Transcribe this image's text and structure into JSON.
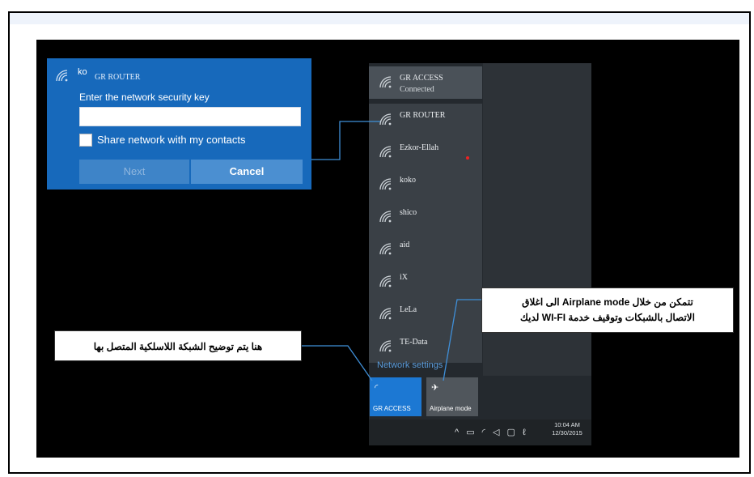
{
  "dialog": {
    "ko_prefix": "ko",
    "network_name": "GR ROUTER",
    "prompt": "Enter the network security key",
    "key_value": "",
    "share_label": "Share network with my contacts",
    "next_label": "Next",
    "cancel_label": "Cancel"
  },
  "flyout": {
    "networks": [
      {
        "name": "GR ACCESS",
        "status": "Connected"
      },
      {
        "name": "GR ROUTER",
        "status": ""
      },
      {
        "name": "Ezkor-Ellah",
        "status": ""
      },
      {
        "name": "koko",
        "status": ""
      },
      {
        "name": "shico",
        "status": ""
      },
      {
        "name": "aid",
        "status": ""
      },
      {
        "name": "iX",
        "status": ""
      },
      {
        "name": "LeLa",
        "status": ""
      },
      {
        "name": "TE-Data",
        "status": ""
      }
    ],
    "network_settings": "Network settings",
    "tiles": {
      "gr_access": "GR ACCESS",
      "airplane": "Airplane mode"
    }
  },
  "taskbar": {
    "time": "10:04 AM",
    "date": "12/30/2015"
  },
  "callouts": {
    "connected_network": "هنا يتم توضيح الشبكة اللاسلكية المتصل بها",
    "airplane_line1": "تتمكن من خلال Airplane mode الى اغلاق",
    "airplane_line2": "الاتصال بالشبكات وتوقيف خدمة WI-FI لديك"
  },
  "colors": {
    "dialog_blue": "#1769bb",
    "flyout_dark": "#24292e",
    "tile_active": "#1c78d3"
  }
}
